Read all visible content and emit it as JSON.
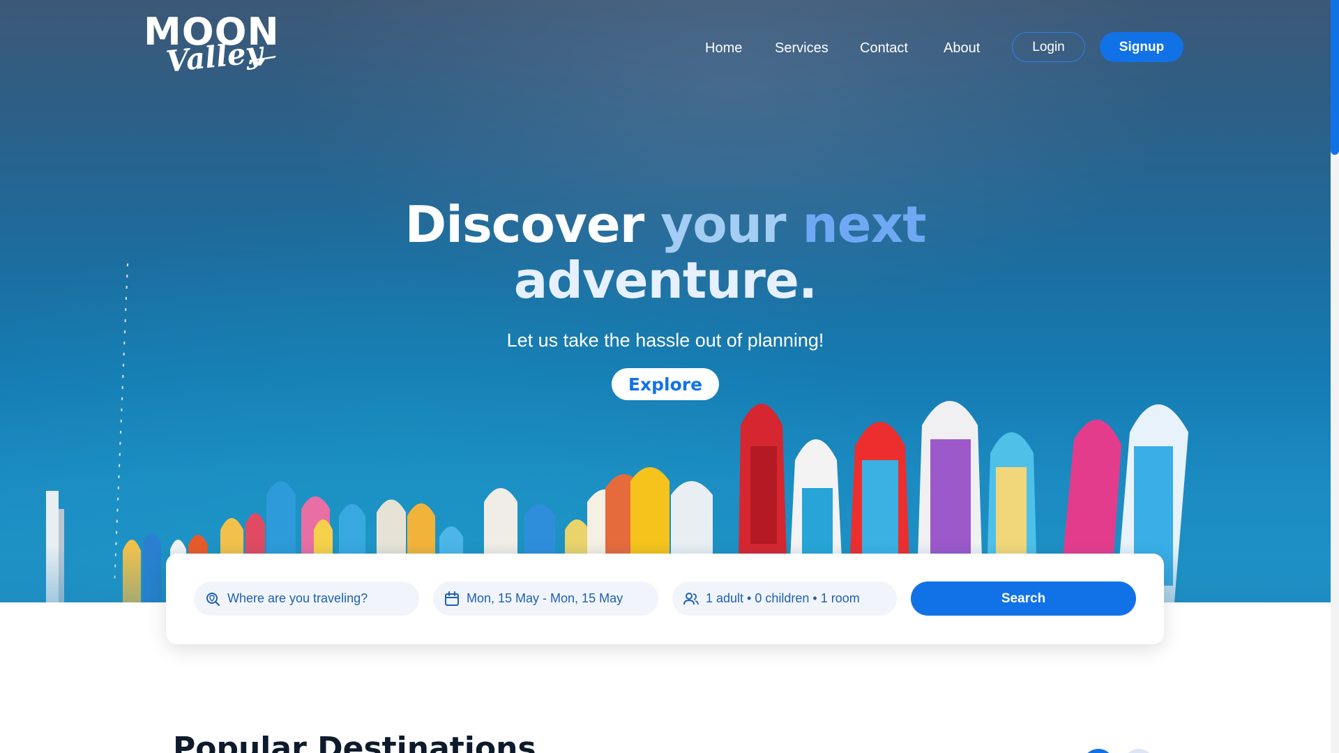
{
  "logo": {
    "top_text": "MOON",
    "bottom_text": "Valley"
  },
  "nav": {
    "items": [
      {
        "label": "Home"
      },
      {
        "label": "Services"
      },
      {
        "label": "Contact"
      },
      {
        "label": "About"
      }
    ],
    "login_label": "Login",
    "signup_label": "Signup"
  },
  "hero": {
    "headline_part1": "Discover",
    "headline_part2": "your",
    "headline_part3": "next",
    "headline_part4": "adventure.",
    "subtitle": "Let us take the hassle out of planning!",
    "cta_label": "Explore"
  },
  "search": {
    "destination_placeholder": "Where are you traveling?",
    "dates_value": "Mon, 15 May - Mon, 15 May",
    "guests_value": "1 adult • 0 children • 1 room",
    "button_label": "Search",
    "icons": {
      "destination": "location-search-icon",
      "dates": "calendar-icon",
      "guests": "users-icon"
    }
  },
  "popular": {
    "title": "Popular Destinations"
  },
  "colors": {
    "accent": "#1172e8",
    "headline_light_blue": "#a3cdf2",
    "headline_blue": "#6fa9f3",
    "field_text": "#1e5fb0",
    "field_bg": "#f1f5fb",
    "title_dark": "#0e1b2c"
  }
}
